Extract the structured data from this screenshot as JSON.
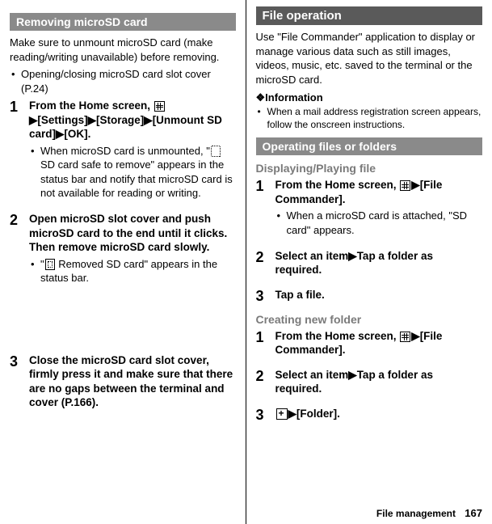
{
  "left": {
    "heading": "Removing microSD card",
    "intro": "Make sure to unmount microSD card (make reading/writing unavailable) before removing.",
    "note1": "Opening/closing microSD card slot cover (P.24)",
    "step1_a": "From the Home screen, ",
    "step1_b": "[Settings]",
    "step1_c": "[Storage]",
    "step1_d": "[Unmount SD card]",
    "step1_e": "[OK].",
    "step1_sub_a": "When microSD card is unmounted, \"",
    "step1_sub_b": " SD card safe to remove\" appears in the status bar and notify that microSD card is not available for reading or writing.",
    "step2": "Open microSD slot cover and push microSD card to the end until it clicks. Then remove microSD card slowly.",
    "step2_sub_a": "\"",
    "step2_sub_b": " Removed SD card\" appears in the status bar.",
    "step3": "Close the microSD card slot cover, firmly press it and make sure that there are no gaps between the terminal and cover (P.166)."
  },
  "right": {
    "heading": "File operation",
    "intro": "Use \"File Commander\" application to display or manage various data such as still images, videos, music, etc. saved to the terminal or the microSD card.",
    "info_label": "❖Information",
    "info_text": "When a mail address registration screen appears, follow the onscreen instructions.",
    "heading2": "Operating files or folders",
    "sub1": "Displaying/Playing file",
    "d_step1_a": "From the Home screen, ",
    "d_step1_b": "[File Commander].",
    "d_step1_sub": "When a microSD card is attached, \"SD card\" appears.",
    "d_step2_a": "Select an item",
    "d_step2_b": "Tap a folder as required.",
    "d_step3": "Tap a file.",
    "sub2": "Creating new folder",
    "c_step1_a": "From the Home screen, ",
    "c_step1_b": "[File Commander].",
    "c_step2_a": "Select an item",
    "c_step2_b": "Tap a folder as required.",
    "c_step3": "[Folder]."
  },
  "footer": {
    "section": "File management",
    "page": "167"
  }
}
